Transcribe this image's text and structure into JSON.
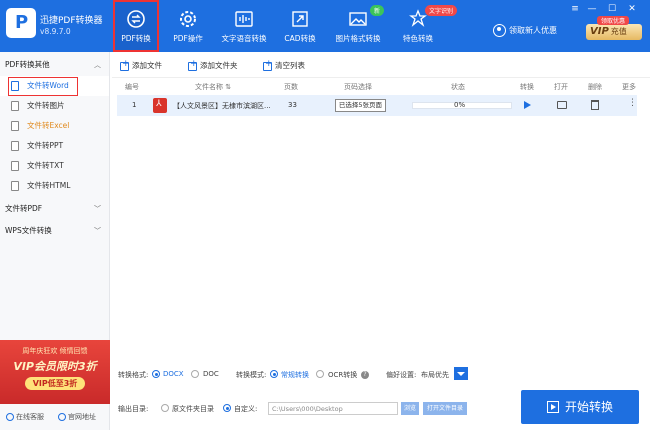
{
  "app": {
    "title": "迅捷PDF转换器",
    "version": "v8.9.7.0"
  },
  "nav": {
    "pdf_convert": "PDF转换",
    "pdf_ops": "PDF操作",
    "voice": "文字语音转换",
    "cad": "CAD转换",
    "image": "图片格式转换",
    "special": "特色转换",
    "badge_new": "新",
    "badge_ocr": "文字识别"
  },
  "header": {
    "coupon": "领取新人优惠",
    "vip_tip": "领取优惠",
    "vip_text": "VIP",
    "vip_label": "充值",
    "win_min": "—",
    "win_close": "✕"
  },
  "sidebar": {
    "group1": "PDF转换其他",
    "items": [
      {
        "label": "文件转Word"
      },
      {
        "label": "文件转图片"
      },
      {
        "label": "文件转Excel"
      },
      {
        "label": "文件转PPT"
      },
      {
        "label": "文件转TXT"
      },
      {
        "label": "文件转HTML"
      }
    ],
    "group2": "文件转PDF",
    "group3": "WPS文件转换",
    "promo_line1": "周年庆狂欢 倾情回馈",
    "promo_line2": "VIP会员限时3折",
    "promo_btn": "VIP低至3折",
    "footer_service": "在线客服",
    "footer_site": "官网地址"
  },
  "toolbar": {
    "add_file": "添加文件",
    "add_folder": "添加文件夹",
    "clear_list": "清空列表"
  },
  "table": {
    "headers": {
      "index": "编号",
      "name": "文件名称 ⇅",
      "pages": "页数",
      "page_select": "页码选择",
      "status": "状态",
      "convert": "转换",
      "open": "打开",
      "delete": "删除",
      "more": "更多"
    },
    "rows": [
      {
        "index": "1",
        "name": "【人文风景区】无棣市滨湖区...",
        "pages": "33",
        "page_select": "已选择5张页面",
        "status": "0%",
        "more": "⋮"
      }
    ]
  },
  "settings": {
    "format_label": "转换格式:",
    "format_docx": "DOCX",
    "format_doc": "DOC",
    "mode_label": "转换模式:",
    "mode_normal": "常规转换",
    "mode_ocr": "OCR转换",
    "help": "?",
    "pref_label": "偏好设置:",
    "pref_value": "布局优先",
    "output_label": "输出目录:",
    "output_source": "原文件夹目录",
    "output_custom": "自定义:",
    "output_path": "C:\\Users\\000\\Desktop",
    "browse": "浏览",
    "open_folder": "打开文件目录",
    "start": "开始转换"
  },
  "colors": {
    "accent": "#1e6fe0",
    "highlight": "#e33333",
    "promo": "#c92a2a"
  }
}
